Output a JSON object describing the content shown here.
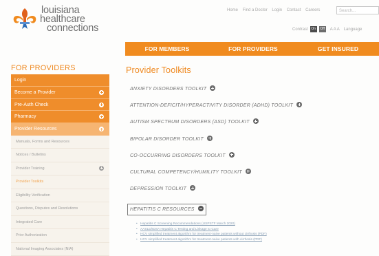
{
  "header": {
    "logo_lines": [
      "louisiana",
      "healthcare",
      "connections"
    ],
    "utility_links": [
      "Home",
      "Find a Doctor",
      "Login",
      "Contact",
      "Careers"
    ],
    "search_placeholder": "Search...",
    "contrast_label": "Contrast",
    "contrast_on": "On",
    "contrast_off": "Off",
    "text_sizes": "A A A",
    "language": "Language"
  },
  "topnav": {
    "members": "FOR MEMBERS",
    "providers": "FOR PROVIDERS",
    "insured": "GET INSURED"
  },
  "sidebar": {
    "title": "FOR PROVIDERS",
    "items": [
      {
        "label": "Login"
      },
      {
        "label": "Become a Provider"
      },
      {
        "label": "Pre-Auth Check"
      },
      {
        "label": "Pharmacy"
      },
      {
        "label": "Provider Resources"
      }
    ],
    "sub_items": [
      {
        "label": "Manuals, Forms and Resources"
      },
      {
        "label": "Notices / Bulletins"
      },
      {
        "label": "Provider Training"
      },
      {
        "label": "Provider Toolkits"
      },
      {
        "label": "Eligibility Verification"
      },
      {
        "label": "Questions, Disputes and Resolutions"
      },
      {
        "label": "Integrated Care"
      },
      {
        "label": "Prior Authorization"
      },
      {
        "label": "National Imaging Associates (NIA)"
      }
    ]
  },
  "main": {
    "title": "Provider Toolkits",
    "toolkits": [
      "ANXIETY DISORDERS TOOLKIT",
      "ATTENTION-DEFICIT/HYPERACTIVITY DISORDER (ADHD) TOOLKIT",
      "AUTISM SPECTRUM DISORDERS (ASD) TOOLKIT",
      "BIPOLAR DISORDER TOOLKIT",
      "CO-OCCURRING DISORDERS TOOLKIT",
      "CULTURAL COMPETENCY/HUMILITY TOOLKIT",
      "DEPRESSION TOOLKIT",
      "HEPATITIS C RESOURCES"
    ],
    "resource_links": [
      "Hepatitis C Screening Recommendations (USPSTF March 2020)",
      "AASLD/IDSA Hepatitis C Testing and Linkage to Care",
      "HCV simplified treatment algorithm for treatment-naive patients without cirrhosis (PDF)",
      "HCV simplified treatment algorithm for treatment-naive patients with cirrhosis (PDF)"
    ]
  },
  "colors": {
    "accent_orange": "#f08b1f",
    "sidebar_orange": "#ef8d2b",
    "sidebar_light": "#f6b572",
    "link_blue": "#8aa0b6"
  }
}
